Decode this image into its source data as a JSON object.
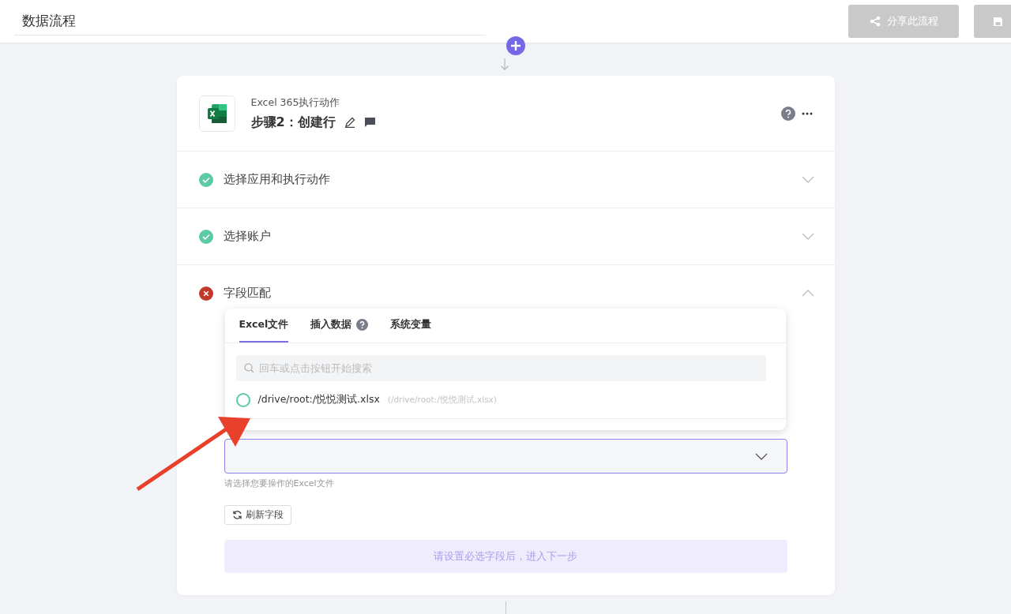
{
  "header": {
    "flow_name": "数据流程",
    "share_button": "分享此流程"
  },
  "step": {
    "app_action": "Excel 365执行动作",
    "title": "步骤2：创建行",
    "sections": [
      {
        "label": "选择应用和执行动作",
        "valid": true,
        "expanded": false
      },
      {
        "label": "选择账户",
        "valid": true,
        "expanded": false
      },
      {
        "label": "字段匹配",
        "valid": false,
        "expanded": true
      }
    ],
    "picker": {
      "tabs": [
        {
          "label": "Excel文件",
          "selected": true,
          "help": false
        },
        {
          "label": "插入数据",
          "selected": false,
          "help": true
        },
        {
          "label": "系统变量",
          "selected": false,
          "help": false
        }
      ],
      "search": {
        "placeholder": "回车或点击按钮开始搜索"
      },
      "options": [
        {
          "name": "/drive/root:/悦悦测试.xlsx",
          "path": "(/drive/root:/悦悦测试.xlsx)",
          "selected": false
        }
      ]
    },
    "file_select": {
      "hint": "请选择您要操作的Excel文件"
    },
    "refresh_button": "刷新字段",
    "next_button": "请设置必选字段后，进入下一步"
  }
}
